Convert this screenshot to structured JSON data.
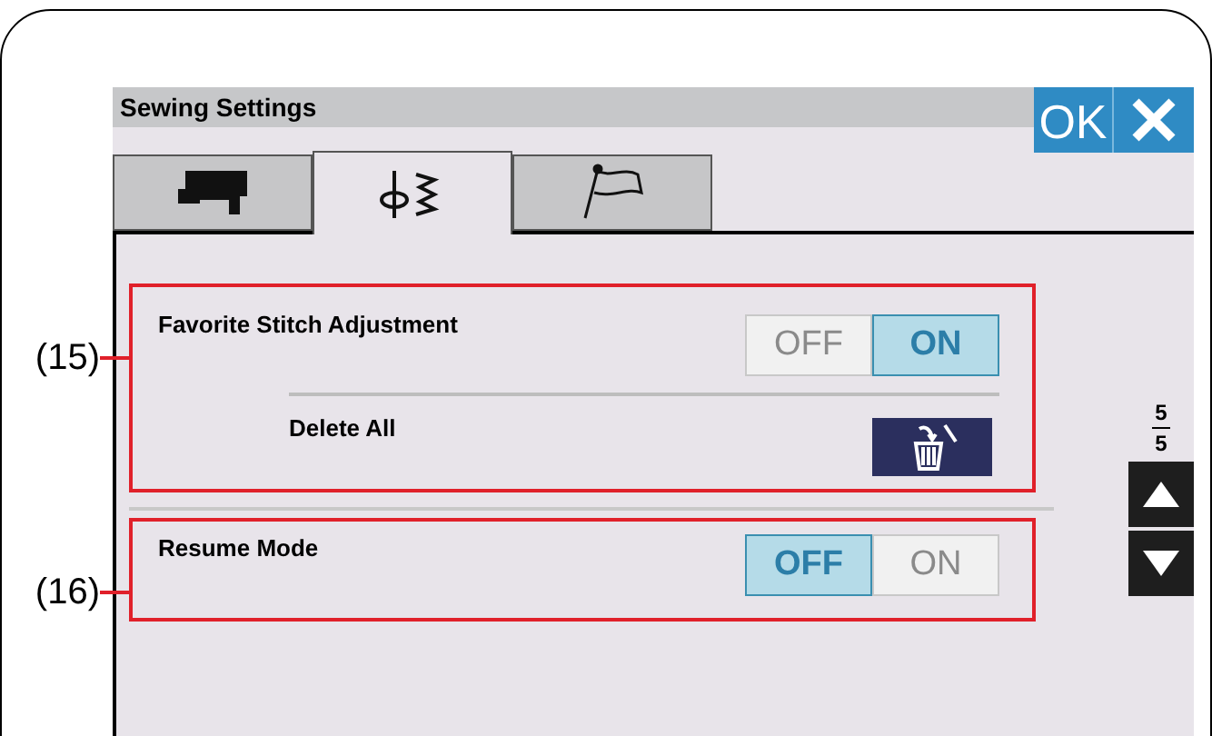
{
  "screen": {
    "title": "Sewing Settings",
    "ok_button": "OK",
    "tabs": [
      {
        "kind": "machine",
        "selected": false
      },
      {
        "kind": "stitch",
        "selected": true
      },
      {
        "kind": "flag",
        "selected": false
      }
    ],
    "settings": [
      {
        "callout": "(15)",
        "label": "Favorite Stitch Adjustment",
        "options": [
          {
            "label": "OFF",
            "selected": false
          },
          {
            "label": "ON",
            "selected": true
          }
        ],
        "sub_label": "Delete All"
      },
      {
        "callout": "(16)",
        "label": "Resume Mode",
        "options": [
          {
            "label": "OFF",
            "selected": true
          },
          {
            "label": "ON",
            "selected": false
          }
        ]
      }
    ],
    "page": {
      "current": "5",
      "total": "5"
    }
  }
}
